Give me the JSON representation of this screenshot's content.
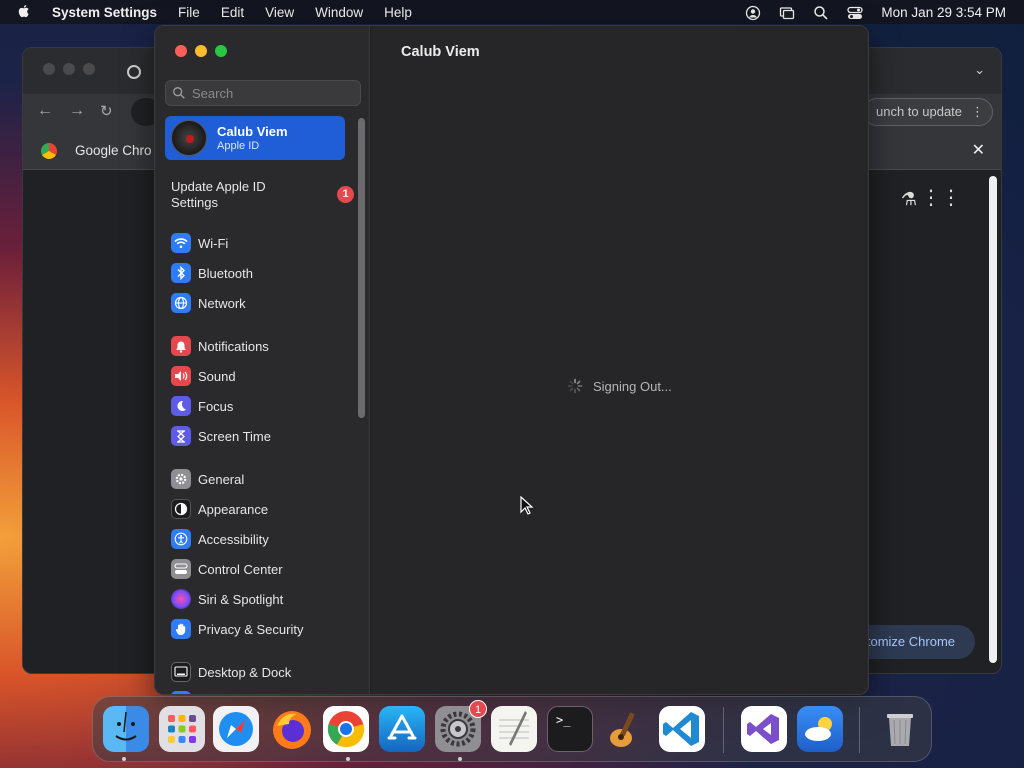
{
  "menubar": {
    "app_name": "System Settings",
    "menus": [
      "File",
      "Edit",
      "View",
      "Window",
      "Help"
    ],
    "datetime": "Mon Jan 29  3:54 PM"
  },
  "chrome": {
    "tab_title": "Google Chro",
    "update_label": "unch to update",
    "customize_label": "tomize Chrome"
  },
  "settings": {
    "search_placeholder": "Search",
    "account": {
      "name": "Calub Viem",
      "subtitle": "Apple ID"
    },
    "update_row": {
      "label": "Update Apple ID Settings",
      "badge": "1"
    },
    "items": [
      {
        "label": "Wi-Fi",
        "icon": "wifi-icon",
        "color": "#2f7cf6"
      },
      {
        "label": "Bluetooth",
        "icon": "bluetooth-icon",
        "color": "#2f7cf6"
      },
      {
        "label": "Network",
        "icon": "globe-icon",
        "color": "#2f7cf6"
      },
      {
        "label": "Notifications",
        "icon": "bell-icon",
        "color": "#e5484d"
      },
      {
        "label": "Sound",
        "icon": "speaker-icon",
        "color": "#e5484d"
      },
      {
        "label": "Focus",
        "icon": "moon-icon",
        "color": "#5e5ce6"
      },
      {
        "label": "Screen Time",
        "icon": "hourglass-icon",
        "color": "#5e5ce6"
      },
      {
        "label": "General",
        "icon": "gear-icon",
        "color": "#8e8e93"
      },
      {
        "label": "Appearance",
        "icon": "appearance-icon",
        "color": "#1c1c1e"
      },
      {
        "label": "Accessibility",
        "icon": "accessibility-icon",
        "color": "#2f7cf6"
      },
      {
        "label": "Control Center",
        "icon": "control-center-icon",
        "color": "#8e8e93"
      },
      {
        "label": "Siri & Spotlight",
        "icon": "siri-icon",
        "color": "#b04bd6"
      },
      {
        "label": "Privacy & Security",
        "icon": "hand-icon",
        "color": "#2f7cf6"
      },
      {
        "label": "Desktop & Dock",
        "icon": "desktop-icon",
        "color": "#1c1c1e"
      }
    ],
    "main_title": "Calub Viem",
    "status": "Signing Out..."
  },
  "dock": {
    "system_settings_badge": "1",
    "apps": [
      "Finder",
      "Launchpad",
      "Safari",
      "Firefox",
      "Chrome",
      "App Store",
      "System Settings",
      "TextEdit",
      "Terminal",
      "GarageBand",
      "VS Code",
      "Visual Studio",
      "Weather",
      "Trash"
    ]
  }
}
